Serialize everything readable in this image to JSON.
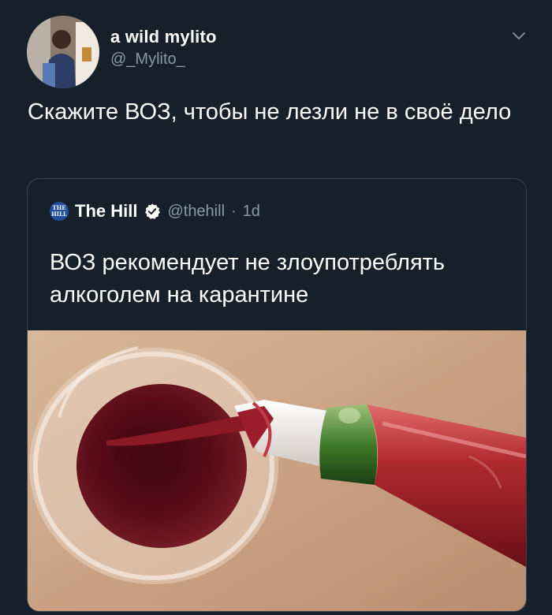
{
  "tweet": {
    "display_name": "a wild mylito",
    "handle": "@_Mylito_",
    "text": "Скажите ВОЗ, чтобы не лезли не в своё дело",
    "avatar_icon": "user-avatar",
    "more_icon": "chevron-down-icon"
  },
  "quote": {
    "logo_line1": "THE",
    "logo_line2": "HILL",
    "name": "The Hill",
    "verified_icon": "verified-badge-icon",
    "handle": "@thehill",
    "separator": "·",
    "time": "1d",
    "text": "ВОЗ рекомендует не злоупотреблять алкоголем на карантине",
    "media": "wine-pouring-photo"
  },
  "colors": {
    "background": "#15202b",
    "border": "#38444d",
    "secondary_text": "#8899a6",
    "verified": "#ffffff",
    "wine": "#5a0c18"
  }
}
